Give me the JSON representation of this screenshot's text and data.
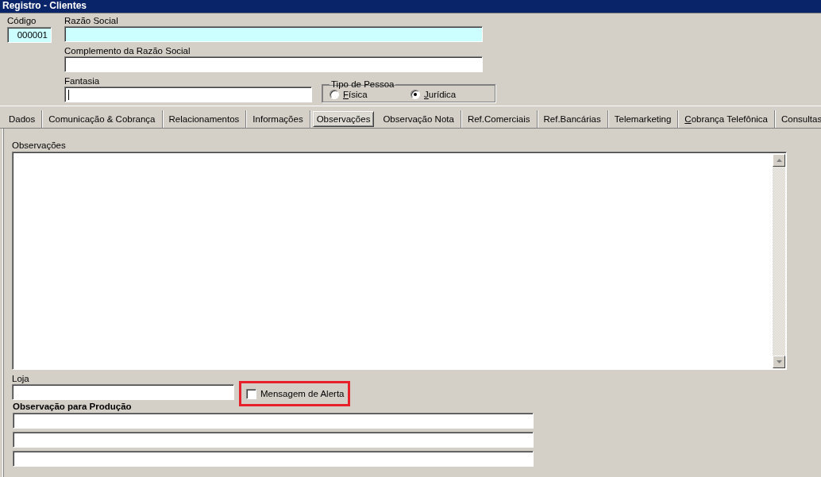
{
  "window": {
    "title": "Registro - Clientes"
  },
  "header_fields": [
    {
      "kind": "code",
      "label": "Código",
      "value": "000001",
      "required": true,
      "focused": false
    },
    {
      "kind": "wide",
      "label": "Razão Social",
      "required": true,
      "focused": false
    },
    {
      "kind": "wide",
      "label": "Complemento da Razão Social",
      "required": false,
      "focused": false
    },
    {
      "kind": "medium",
      "label": "Fantasia",
      "required": false,
      "focused": true
    }
  ],
  "tipo_de_pessoa": {
    "label": "Tipo de Pessoa",
    "options": [
      {
        "label": "Física",
        "mnemonic": true,
        "selected": false
      },
      {
        "label": "Jurídica",
        "mnemonic": true,
        "selected": true
      }
    ]
  },
  "tabs": [
    {
      "label": "Dados",
      "mnemonic": false,
      "selected": false
    },
    {
      "label": "Comunicação & Cobrança",
      "mnemonic": false,
      "selected": false
    },
    {
      "label": "Relacionamentos",
      "mnemonic": false,
      "selected": false
    },
    {
      "label": "Informações",
      "mnemonic": false,
      "selected": false
    },
    {
      "label": "Observações",
      "mnemonic": false,
      "selected": true
    },
    {
      "label": "Observação Nota",
      "mnemonic": false,
      "selected": false
    },
    {
      "label": "Ref.Comerciais",
      "mnemonic": false,
      "selected": false
    },
    {
      "label": "Ref.Bancárias",
      "mnemonic": false,
      "selected": false
    },
    {
      "label": "Telemarketing",
      "mnemonic": false,
      "selected": false
    },
    {
      "label": "Cobrança Telefônica",
      "mnemonic": true,
      "selected": false
    },
    {
      "label": "Consultas",
      "mnemonic": false,
      "selected": false
    }
  ],
  "observacoes": {
    "label": "Observações"
  },
  "loja": {
    "label": "Loja"
  },
  "mensagem_de_alerta": {
    "label": "Mensagem de Alerta",
    "checked": false,
    "highlighted": true
  },
  "observacao_para_producao": {
    "label": "Observação para Produção",
    "lines": [
      {
        "kind": "text_line"
      },
      {
        "kind": "text_line"
      },
      {
        "kind": "text_line"
      }
    ]
  }
}
